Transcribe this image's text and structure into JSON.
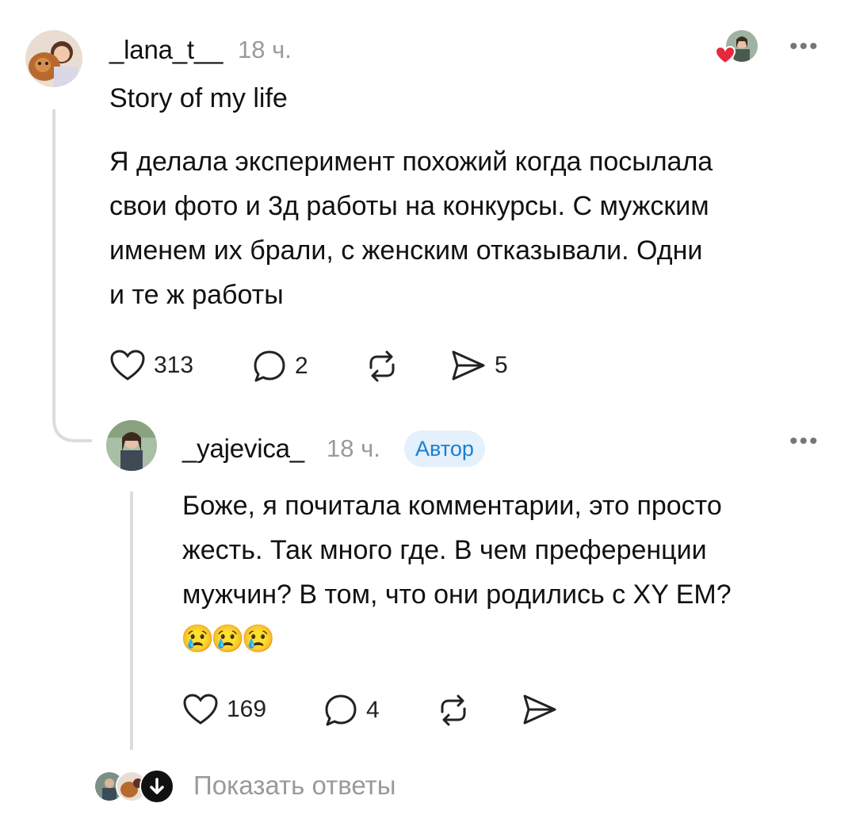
{
  "post": {
    "username": "_lana_t__",
    "time": "18 ч.",
    "title_line": "Story of my life",
    "body_lines": [
      "Я делала эксперимент похожий когда посылала",
      "свои фото и 3д работы на конкурсы. С мужским",
      "именем их брали, с женским отказывали. Одни",
      "и те ж работы"
    ],
    "likes": "313",
    "replies": "2",
    "shares": "5",
    "more_label": "•••"
  },
  "reply": {
    "username": "_yajevica_",
    "time": "18 ч.",
    "badge": "Автор",
    "body_lines": [
      "Боже, я почитала комментарии, это просто",
      "жесть. Так много где. В чем преференции",
      "мужчин? В том, что они родились с XY ЕМ?",
      "😢😢😢"
    ],
    "likes": "169",
    "replies": "4",
    "more_label": "•••"
  },
  "footer": {
    "show_replies": "Показать ответы"
  },
  "colors": {
    "like_heart": "#e8283c",
    "badge_bg": "#e4f0fb",
    "badge_text": "#1b7fd1",
    "muted": "#9a9a9a"
  }
}
